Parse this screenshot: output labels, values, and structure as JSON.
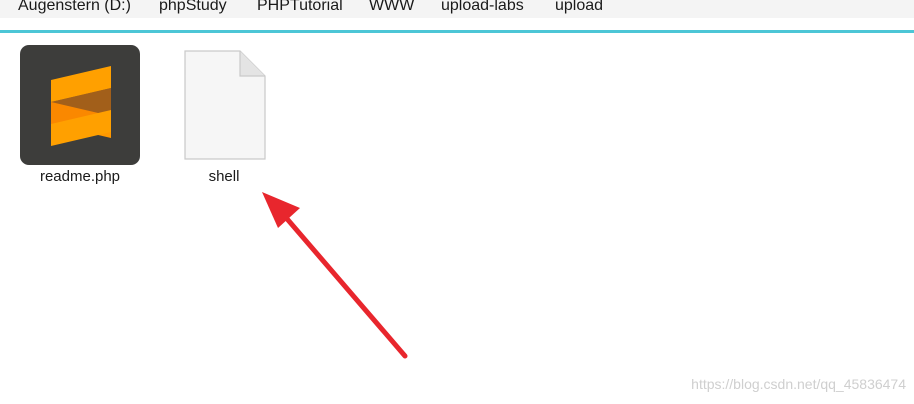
{
  "breadcrumb": {
    "items": [
      {
        "label": "Augenstern (D:)"
      },
      {
        "label": "phpStudy"
      },
      {
        "label": "PHPTutorial"
      },
      {
        "label": "WWW"
      },
      {
        "label": "upload-labs"
      },
      {
        "label": "upload"
      }
    ]
  },
  "colors": {
    "accent": "#4cc6d6",
    "sublime_bg": "#3d3d3b",
    "sublime_orange": "#ff9800",
    "arrow": "#e8262d"
  },
  "files": [
    {
      "name": "readme.php",
      "icon": "sublime-text-file-icon"
    },
    {
      "name": "shell",
      "icon": "blank-file-icon"
    }
  ],
  "watermark": "https://blog.csdn.net/qq_45836474"
}
